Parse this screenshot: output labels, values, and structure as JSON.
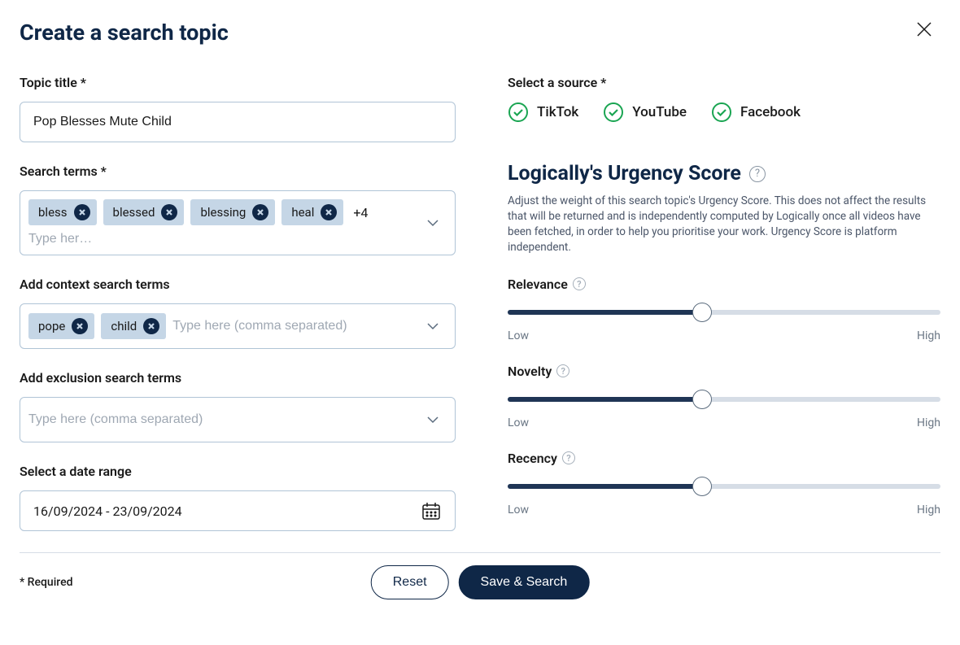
{
  "header": {
    "title": "Create a search topic"
  },
  "left": {
    "topic_title_label": "Topic title *",
    "topic_title_value": "Pop Blesses Mute Child",
    "search_terms_label": "Search terms *",
    "search_terms": [
      "bless",
      "blessed",
      "blessing",
      "heal"
    ],
    "search_terms_more": "+4",
    "search_terms_placeholder": "Type her…",
    "context_label": "Add context search terms",
    "context_terms": [
      "pope",
      "child"
    ],
    "context_placeholder": "Type here (comma separated)",
    "exclusion_label": "Add exclusion search terms",
    "exclusion_placeholder": "Type here (comma separated)",
    "date_label": "Select a date range",
    "date_value": "16/09/2024 - 23/09/2024"
  },
  "right": {
    "source_label": "Select a source *",
    "sources": [
      "TikTok",
      "YouTube",
      "Facebook"
    ],
    "urgency_title": "Logically's Urgency Score",
    "urgency_desc": "Adjust the weight of this search topic's Urgency Score. This does not affect the results that will be returned and is independently computed by Logically once all videos have been fetched, in order to help you prioritise your work. Urgency Score is platform independent.",
    "sliders": {
      "relevance": {
        "label": "Relevance",
        "value": 45,
        "low": "Low",
        "high": "High"
      },
      "novelty": {
        "label": "Novelty",
        "value": 45,
        "low": "Low",
        "high": "High"
      },
      "recency": {
        "label": "Recency",
        "value": 45,
        "low": "Low",
        "high": "High"
      }
    }
  },
  "footer": {
    "required": "* Required",
    "reset": "Reset",
    "save": "Save & Search"
  }
}
